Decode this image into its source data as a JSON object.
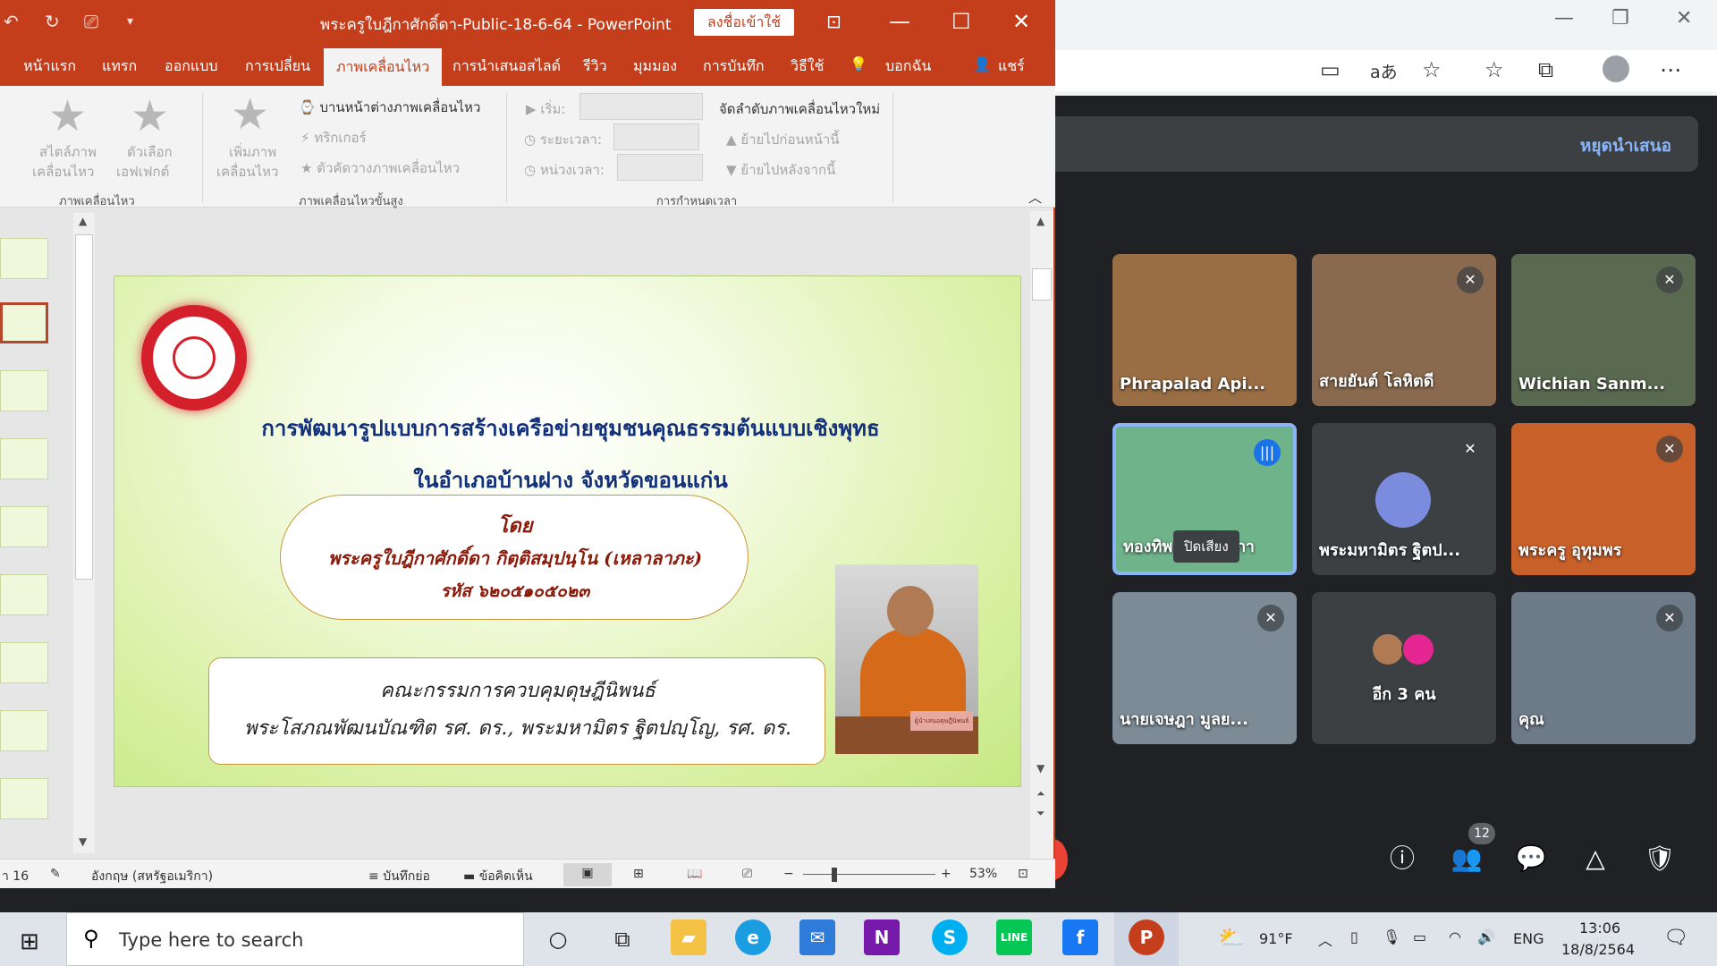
{
  "browser": {
    "meet": {
      "stop_presenting": "หยุดนำเสนอ",
      "participants": [
        {
          "name": "Phrapalad Api...",
          "muted": false,
          "bg": "#9a6e44"
        },
        {
          "name": "สายยันต์ โลหิตดี",
          "muted": true,
          "bg": "#8a6a4e"
        },
        {
          "name": "Wichian Sanm...",
          "muted": true,
          "bg": "#5a6a50"
        },
        {
          "name": "ทองทิพย์ ไชยาสภา",
          "muted": false,
          "speaking": true,
          "bg": "#6fb38a"
        },
        {
          "name": "พระมหามิตร ฐิตป...",
          "muted": true,
          "bg": "#3c4043"
        },
        {
          "name": "พระครู อุทุมพร",
          "muted": true,
          "bg": "#c8602a"
        },
        {
          "name": "นายเจษฎา มูลย...",
          "muted": true,
          "bg": "#7d8b96"
        },
        {
          "name": "อีก 3 คน",
          "muted": false,
          "bg": "#3c4043"
        },
        {
          "name": "คุณ",
          "muted": true,
          "bg": "#6d7a88"
        }
      ],
      "mute_tag": "ปิดเสียง",
      "people_count": "12"
    }
  },
  "ppt": {
    "title": "พระครูใบฎีกาศักดิ์ดา-Public-18-6-64  -  PowerPoint",
    "signin": "ลงชื่อเข้าใช้",
    "tabs": [
      "หน้าแรก",
      "แทรก",
      "ออกแบบ",
      "การเปลี่ยน",
      "ภาพเคลื่อนไหว",
      "การนำเสนอสไลด์",
      "รีวิว",
      "มุมมอง",
      "การบันทึก",
      "วิธีใช้",
      "บอกฉัน",
      "แชร์"
    ],
    "ribbon": {
      "anim_styles": "สไตล์ภาพ",
      "anim_styles2": "เคลื่อนไหว",
      "effect_options": "ตัวเลือก",
      "effect_options2": "เอฟเฟกต์",
      "group_animation": "ภาพเคลื่อนไหว",
      "add_anim": "เพิ่มภาพ",
      "add_anim2": "เคลื่อนไหว",
      "anim_pane": "บานหน้าต่างภาพเคลื่อนไหว",
      "trigger": "ทริกเกอร์",
      "anim_painter": "ตัวคัดวางภาพเคลื่อนไหว",
      "group_advanced": "ภาพเคลื่อนไหวขั้นสูง",
      "start": "เริ่ม:",
      "duration": "ระยะเวลา:",
      "delay": "หน่วงเวลา:",
      "reorder": "จัดลำดับภาพเคลื่อนไหวใหม่",
      "move_earlier": "ย้ายไปก่อนหน้านี้",
      "move_later": "ย้ายไปหลังจากนี้",
      "group_timing": "การกำหนดเวลา"
    },
    "slide": {
      "title_line1": "การพัฒนารูปแบบการสร้างเครือข่ายชุมชนคุณธรรมต้นแบบเชิงพุทธ",
      "title_line2": "ในอำเภอบ้านฝาง จังหวัดขอนแก่น",
      "by": "โดย",
      "author": "พระครูใบฎีกาศักดิ์ดา กิตฺติสมฺปนฺโน (เหลาลาภะ)",
      "student_id": "รหัส ๖๒๐๕๑๐๕๐๒๓",
      "committee": "คณะกรรมการควบคุมดุษฎีนิพนธ์",
      "advisors": "พระโสภณพัฒนบัณฑิต รศ. ดร., พระมหามิตร ฐิตปญฺโญ, รศ. ดร.",
      "photo_caption": "ผู้นำเสนอดุษฎีนิพนธ์"
    },
    "status": {
      "slide_num": "า 16",
      "language": "อังกฤษ (สหรัฐอเมริกา)",
      "notes": "บันทึกย่อ",
      "comments": "ข้อคิดเห็น",
      "zoom": "53%"
    }
  },
  "taskbar": {
    "search_placeholder": "Type here to search",
    "weather": "91°F",
    "lang": "ENG",
    "time": "13:06",
    "date": "18/8/2564"
  }
}
